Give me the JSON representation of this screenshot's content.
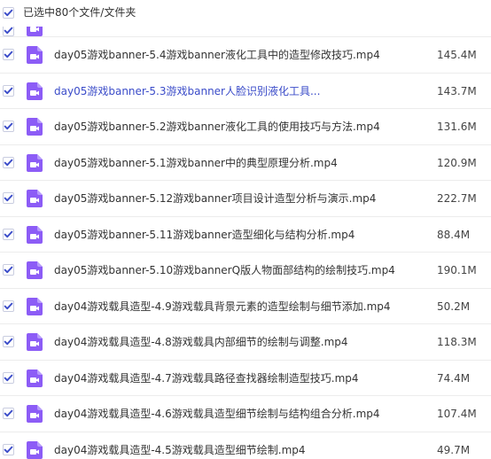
{
  "header": {
    "selection_label": "已选中80个文件/文件夹"
  },
  "colors": {
    "check_blue": "#3b4cc9",
    "video_icon_purple": "#8c5cf6",
    "link_text": "#3b4cc9"
  },
  "icons": {
    "checkbox": "checkbox-checked-icon",
    "file": "video-file-icon"
  },
  "files": [
    {
      "name": "day05游戏banner-5.4游戏banner液化工具中的造型修改技巧.mp4",
      "size": "145.4M"
    },
    {
      "name": "day05游戏banner-5.3游戏banner人脸识别液化工具...",
      "size": "143.7M"
    },
    {
      "name": "day05游戏banner-5.2游戏banner液化工具的使用技巧与方法.mp4",
      "size": "131.6M"
    },
    {
      "name": "day05游戏banner-5.1游戏banner中的典型原理分析.mp4",
      "size": "120.9M"
    },
    {
      "name": "day05游戏banner-5.12游戏banner项目设计造型分析与演示.mp4",
      "size": "222.7M"
    },
    {
      "name": "day05游戏banner-5.11游戏banner造型细化与结构分析.mp4",
      "size": "88.4M"
    },
    {
      "name": "day05游戏banner-5.10游戏bannerQ版人物面部结构的绘制技巧.mp4",
      "size": "190.1M"
    },
    {
      "name": "day04游戏载具造型-4.9游戏载具背景元素的造型绘制与细节添加.mp4",
      "size": "50.2M"
    },
    {
      "name": "day04游戏载具造型-4.8游戏载具内部细节的绘制与调整.mp4",
      "size": "118.3M"
    },
    {
      "name": "day04游戏载具造型-4.7游戏载具路径查找器绘制造型技巧.mp4",
      "size": "74.4M"
    },
    {
      "name": "day04游戏载具造型-4.6游戏载具造型细节绘制与结构组合分析.mp4",
      "size": "107.4M"
    },
    {
      "name": "day04游戏载具造型-4.5游戏载具造型细节绘制.mp4",
      "size": "49.7M"
    }
  ]
}
